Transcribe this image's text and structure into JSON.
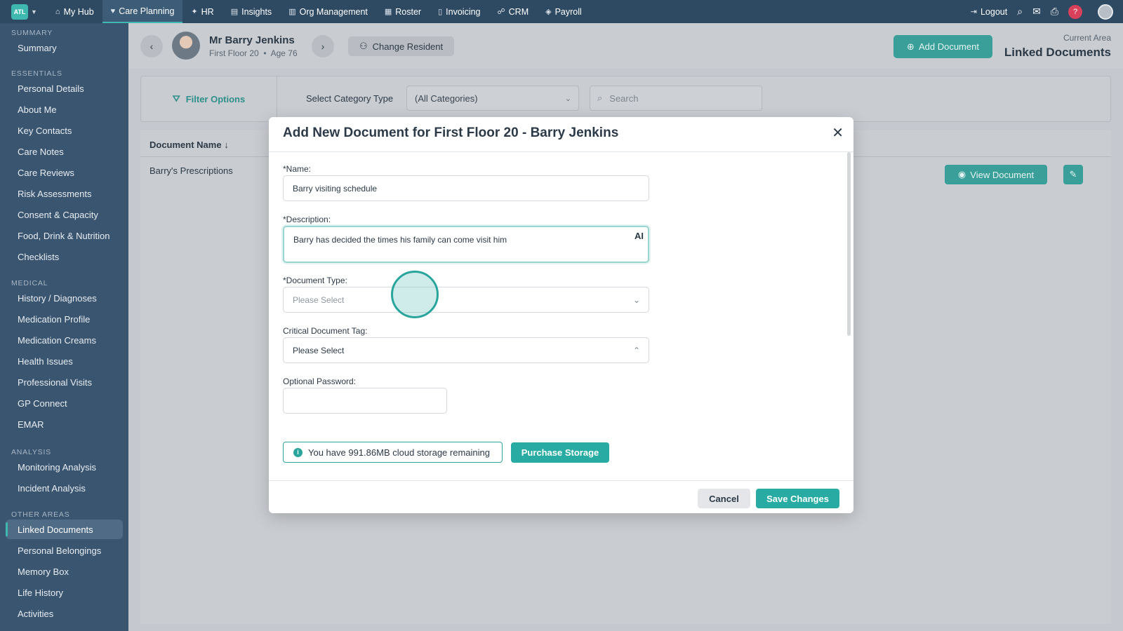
{
  "topnav": {
    "org_badge": "ATL",
    "items": [
      {
        "label": "My Hub",
        "icon": "⌂"
      },
      {
        "label": "Care Planning",
        "icon": "♥"
      },
      {
        "label": "HR",
        "icon": "✦"
      },
      {
        "label": "Insights",
        "icon": "▤"
      },
      {
        "label": "Org Management",
        "icon": "▥"
      },
      {
        "label": "Roster",
        "icon": "▦"
      },
      {
        "label": "Invoicing",
        "icon": "▯"
      },
      {
        "label": "CRM",
        "icon": "☍"
      },
      {
        "label": "Payroll",
        "icon": "◈"
      }
    ],
    "logout_label": "Logout",
    "help_label": "?"
  },
  "sidebar": {
    "sections": [
      {
        "title": "SUMMARY",
        "items": [
          "Summary"
        ]
      },
      {
        "title": "ESSENTIALS",
        "items": [
          "Personal Details",
          "About Me",
          "Key Contacts",
          "Care Notes",
          "Care Reviews",
          "Risk Assessments",
          "Consent & Capacity",
          "Food, Drink & Nutrition",
          "Checklists"
        ]
      },
      {
        "title": "MEDICAL",
        "items": [
          "History / Diagnoses",
          "Medication Profile",
          "Medication Creams",
          "Health Issues",
          "Professional Visits",
          "GP Connect",
          "EMAR"
        ]
      },
      {
        "title": "ANALYSIS",
        "items": [
          "Monitoring Analysis",
          "Incident Analysis"
        ]
      },
      {
        "title": "OTHER AREAS",
        "items": [
          "Linked Documents",
          "Personal Belongings",
          "Memory Box",
          "Life History",
          "Activities"
        ]
      }
    ],
    "active_item": "Linked Documents"
  },
  "resident": {
    "name": "Mr Barry Jenkins",
    "location": "First Floor 20",
    "age": "Age 76",
    "change_label": "Change Resident"
  },
  "header": {
    "add_document_label": "Add Document",
    "current_area_label": "Current Area",
    "current_area_value": "Linked Documents"
  },
  "filter": {
    "options_label": "Filter Options",
    "category_label": "Select Category Type",
    "category_value": "(All Categories)",
    "search_placeholder": "Search"
  },
  "table": {
    "column_document_name": "Document Name",
    "rows": [
      {
        "name": "Barry's Prescriptions",
        "view_label": "View Document"
      }
    ]
  },
  "modal": {
    "title": "Add New Document for First Floor 20 - Barry Jenkins",
    "name_label": "*Name:",
    "name_value": "Barry visiting schedule",
    "description_label": "*Description:",
    "description_value": "Barry has decided the times his family can come visit him",
    "ai_label": "AI",
    "document_type_label": "*Document Type:",
    "document_type_placeholder": "Please Select",
    "critical_tag_label": "Critical Document Tag:",
    "critical_tag_value": "Please Select",
    "password_label": "Optional Password:",
    "storage_text": "You have 991.86MB cloud storage remaining",
    "purchase_label": "Purchase Storage",
    "cancel_label": "Cancel",
    "save_label": "Save Changes"
  },
  "colors": {
    "nav_bg": "#2e4a63",
    "sidebar_bg": "#3a5570",
    "accent": "#27aba3"
  }
}
